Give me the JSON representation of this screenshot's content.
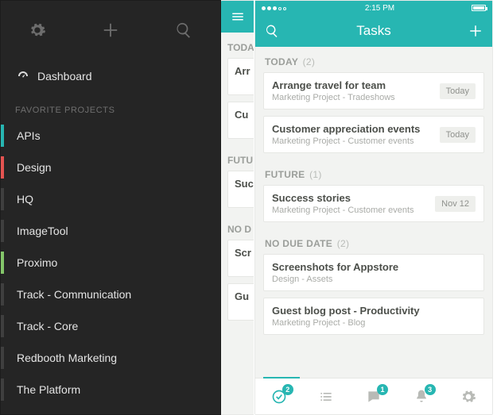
{
  "statusbar": {
    "time": "2:15 PM"
  },
  "navbar": {
    "title": "Tasks"
  },
  "sections": {
    "today": {
      "label": "TODAY",
      "count": "(2)"
    },
    "future": {
      "label": "FUTURE",
      "count": "(1)"
    },
    "nodate": {
      "label": "NO DUE DATE",
      "count": "(2)"
    }
  },
  "tasks": {
    "today": [
      {
        "title": "Arrange travel for team",
        "subtitle": "Marketing Project - Tradeshows",
        "due": "Today"
      },
      {
        "title": "Customer appreciation events",
        "subtitle": "Marketing Project - Customer events",
        "due": "Today"
      }
    ],
    "future": [
      {
        "title": "Success stories",
        "subtitle": "Marketing Project - Customer events",
        "due": "Nov 12"
      }
    ],
    "nodate": [
      {
        "title": "Screenshots for Appstore",
        "subtitle": "Design - Assets"
      },
      {
        "title": "Guest blog post - Productivity",
        "subtitle": "Marketing Project - Blog"
      }
    ]
  },
  "tabs": {
    "badges": {
      "tasks": "2",
      "chat": "1",
      "alerts": "3"
    }
  },
  "mid": {
    "sections": {
      "today": "TODA",
      "future": "FUTU",
      "nodate": "NO D"
    },
    "items": [
      {
        "t": "Arr"
      },
      {
        "t": "Cu"
      },
      {
        "t": "Suc"
      },
      {
        "t": "Scr"
      },
      {
        "t": "Gu"
      }
    ]
  },
  "drawer": {
    "dashboard": "Dashboard",
    "groupLabel": "FAVORITE PROJECTS",
    "projects": [
      {
        "label": "APIs",
        "color": "#27b6b2"
      },
      {
        "label": "Design",
        "color": "#e55451"
      },
      {
        "label": "HQ",
        "color": "#3f3f3f"
      },
      {
        "label": "ImageTool",
        "color": "#3f3f3f"
      },
      {
        "label": "Proximo",
        "color": "#84c66a"
      },
      {
        "label": "Track - Communication",
        "color": "#3f3f3f"
      },
      {
        "label": "Track - Core",
        "color": "#3f3f3f"
      },
      {
        "label": "Redbooth Marketing",
        "color": "#3f3f3f"
      },
      {
        "label": "The Platform",
        "color": "#3f3f3f"
      }
    ]
  }
}
